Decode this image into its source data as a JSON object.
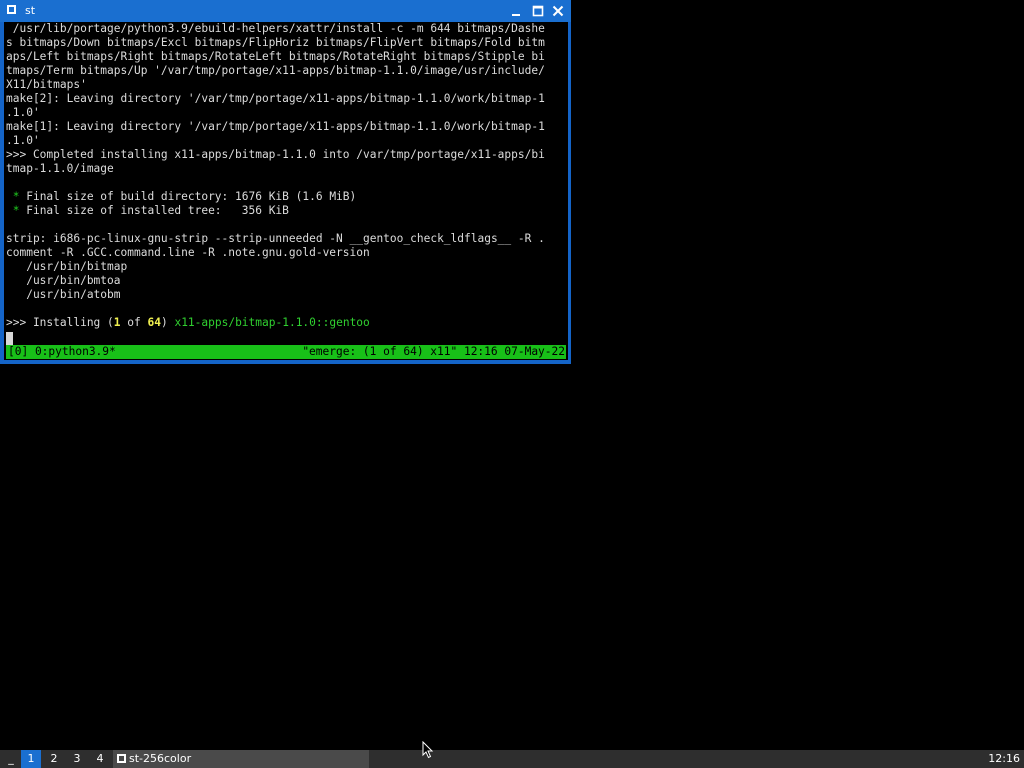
{
  "window": {
    "title": "st"
  },
  "terminal": {
    "lines": [
      " /usr/lib/portage/python3.9/ebuild-helpers/xattr/install -c -m 644 bitmaps/Dashe",
      "s bitmaps/Down bitmaps/Excl bitmaps/FlipHoriz bitmaps/FlipVert bitmaps/Fold bitm",
      "aps/Left bitmaps/Right bitmaps/RotateLeft bitmaps/RotateRight bitmaps/Stipple bi",
      "tmaps/Term bitmaps/Up '/var/tmp/portage/x11-apps/bitmap-1.1.0/image/usr/include/",
      "X11/bitmaps'",
      "make[2]: Leaving directory '/var/tmp/portage/x11-apps/bitmap-1.1.0/work/bitmap-1",
      ".1.0'",
      "make[1]: Leaving directory '/var/tmp/portage/x11-apps/bitmap-1.1.0/work/bitmap-1",
      ".1.0'",
      ">>> Completed installing x11-apps/bitmap-1.1.0 into /var/tmp/portage/x11-apps/bi",
      "tmap-1.1.0/image",
      "",
      "",
      "",
      "",
      "strip: i686-pc-linux-gnu-strip --strip-unneeded -N __gentoo_check_ldflags__ -R .",
      "comment -R .GCC.command.line -R .note.gnu.gold-version",
      "   /usr/bin/bitmap",
      "   /usr/bin/bmtoa",
      "   /usr/bin/atobm"
    ],
    "final_size_build": {
      "star": " * ",
      "text": "Final size of build directory: 1676 KiB (1.6 MiB)"
    },
    "final_size_tree": {
      "star": " * ",
      "text": "Final size of installed tree:   356 KiB"
    },
    "installing": {
      "prefix": ">>> Installing (",
      "current": "1",
      "of": " of ",
      "total": "64",
      "close": ") ",
      "package": "x11-apps/bitmap-1.1.0::gentoo"
    }
  },
  "tmux_status": {
    "left": "[0] 0:python3.9*",
    "right": "\"emerge: (1 of 64) x11\" 12:16 07-May-22"
  },
  "taskbar": {
    "launcher": "_",
    "workspaces": [
      "1",
      "2",
      "3",
      "4"
    ],
    "task_label": "st-256color",
    "clock": "12:16"
  },
  "colors": {
    "window_border": "#1464c8",
    "status_bar": "#18c018",
    "highlight_number": "#f0f050",
    "package_green": "#30d030",
    "taskbar_bg": "#2e2e2e",
    "active_workspace": "#1a6fd0"
  },
  "icons": {
    "window_icon": "window-icon",
    "minimize": "minimize-icon",
    "maximize": "maximize-icon",
    "close": "close-icon",
    "pointer": "mouse-pointer-icon"
  }
}
